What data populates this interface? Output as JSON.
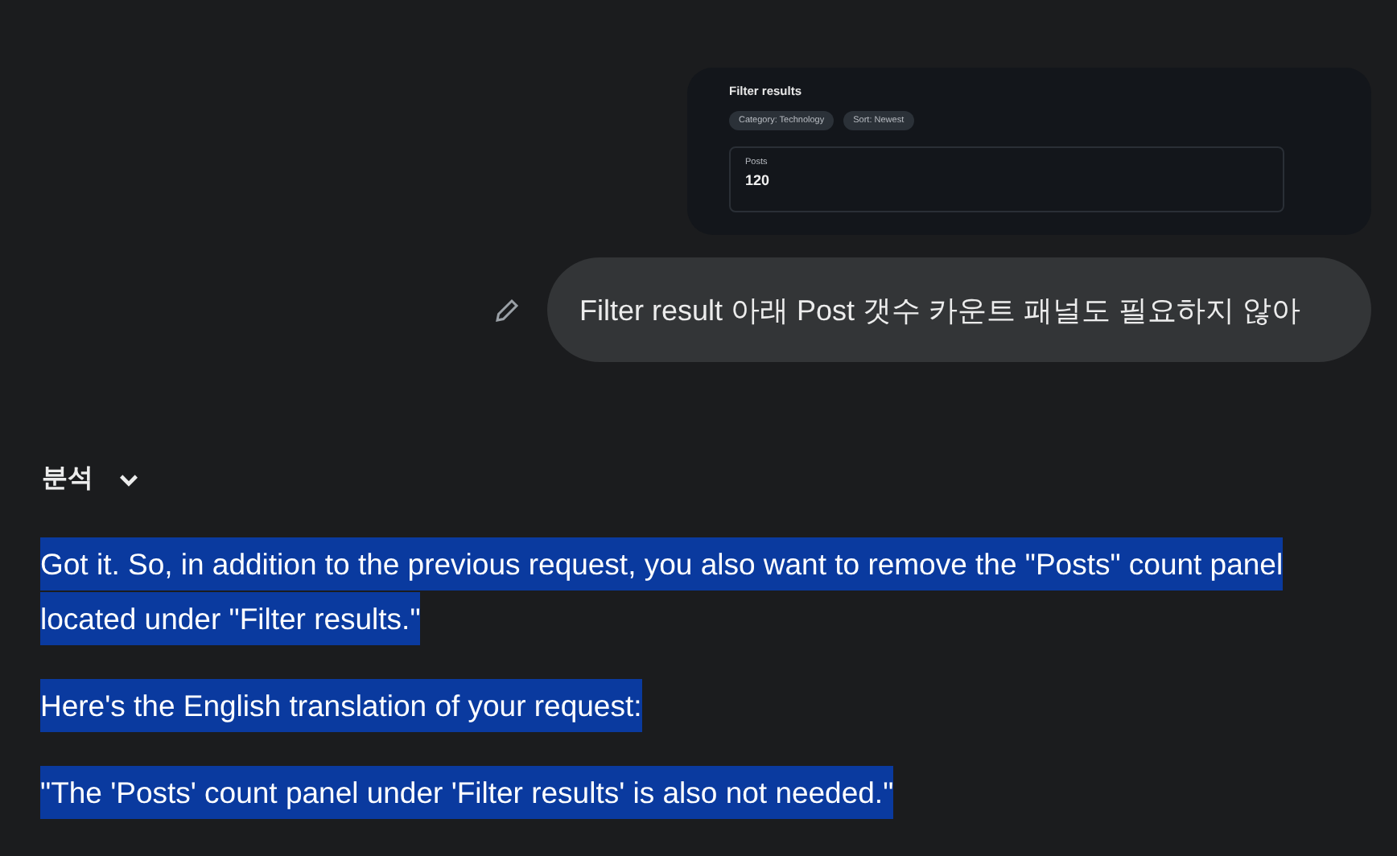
{
  "attachment": {
    "title": "Filter results",
    "chips": [
      "Category: Technology",
      "Sort: Newest"
    ],
    "stat": {
      "label": "Posts",
      "value": "120"
    }
  },
  "user_message": {
    "text": "Filter result 아래 Post 갯수 카운트 패널도 필요하지 않아"
  },
  "analysis_toggle": {
    "label": "분석",
    "expanded": false
  },
  "response": [
    {
      "text": "Got it. So, in addition to the previous request, you also want to remove the \"Posts\" count panel located under \"Filter results.\"",
      "highlighted": true
    },
    {
      "text": "Here's the English translation of your request:",
      "highlighted": true
    },
    {
      "text": "\"The 'Posts' count panel under 'Filter results' is also not needed.\"",
      "highlighted": true
    }
  ]
}
